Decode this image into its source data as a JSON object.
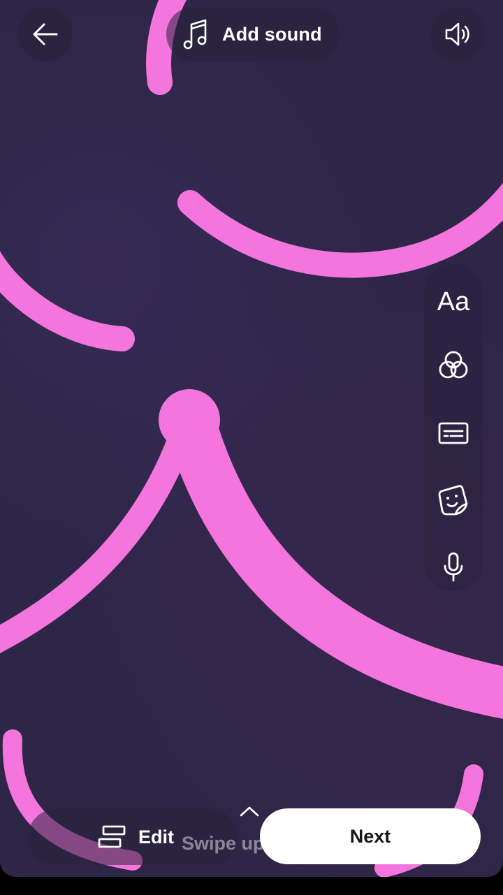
{
  "header": {
    "add_sound_label": "Add sound",
    "back_icon": "arrow-left-icon",
    "sound_icon": "music-note-icon",
    "volume_icon": "speaker-icon"
  },
  "toolbar": {
    "text_label": "Aa",
    "items": [
      "text-icon",
      "filters-icon",
      "captions-icon",
      "sticker-icon",
      "microphone-icon"
    ]
  },
  "bottom": {
    "edit_label": "Edit",
    "swipe_label": "Swipe up",
    "next_label": "Next",
    "edit_icon": "layout-edit-icon"
  },
  "colors": {
    "background": "#2d2647",
    "stroke": "#f575df",
    "next_button": "#ffffff"
  }
}
